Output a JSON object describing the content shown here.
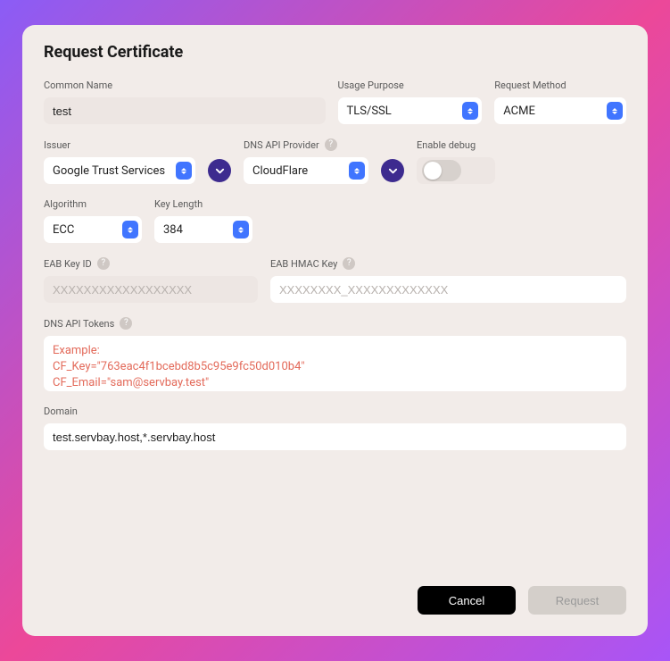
{
  "title": "Request Certificate",
  "labels": {
    "commonName": "Common Name",
    "usagePurpose": "Usage Purpose",
    "requestMethod": "Request Method",
    "issuer": "Issuer",
    "dnsProvider": "DNS API Provider",
    "enableDebug": "Enable debug",
    "algorithm": "Algorithm",
    "keyLength": "Key Length",
    "eabKeyId": "EAB Key ID",
    "eabHmacKey": "EAB HMAC Key",
    "dnsTokens": "DNS API Tokens",
    "domain": "Domain"
  },
  "values": {
    "commonName": "test",
    "usagePurpose": "TLS/SSL",
    "requestMethod": "ACME",
    "issuer": "Google Trust Services",
    "dnsProvider": "CloudFlare",
    "enableDebug": false,
    "algorithm": "ECC",
    "keyLength": "384",
    "eabKeyId": "",
    "eabHmacKey": "",
    "dnsTokens": "",
    "domain": "test.servbay.host,*.servbay.host"
  },
  "placeholders": {
    "eabKeyId": "XXXXXXXXXXXXXXXXXX",
    "eabHmacKey": "XXXXXXXX_XXXXXXXXXXXXX",
    "dnsTokens": "Example:\nCF_Key=\"763eac4f1bcebd8b5c95e9fc50d010b4\"\nCF_Email=\"sam@servbay.test\""
  },
  "buttons": {
    "cancel": "Cancel",
    "request": "Request"
  }
}
